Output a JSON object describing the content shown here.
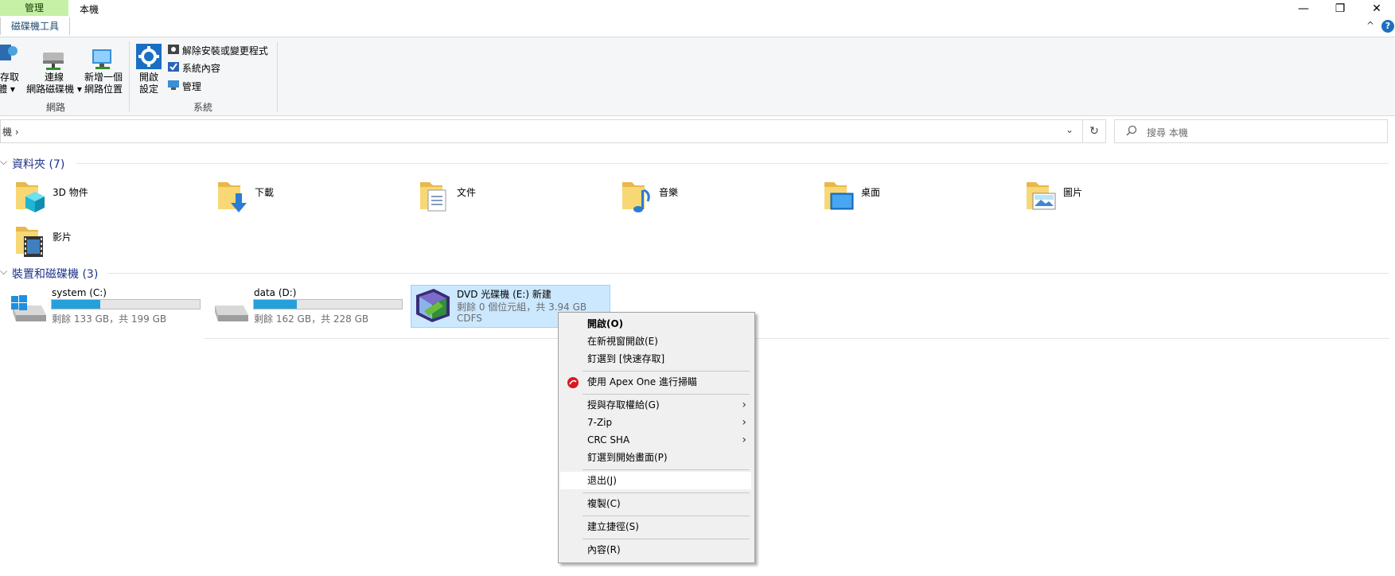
{
  "title": {
    "manage_tab": "管理",
    "context_tab": "磁碟機工具",
    "window_title": "本機"
  },
  "window_controls": {
    "minimize": "—",
    "maximize": "❐",
    "close": "✕",
    "collapse": "^",
    "help": "?"
  },
  "ribbon": {
    "network_group": {
      "label": "網路",
      "access_media": [
        "存取",
        "媒體 ▾"
      ],
      "map_drive": [
        "連線",
        "網路磁碟機 ▾"
      ],
      "add_location": [
        "新增一個",
        "網路位置"
      ]
    },
    "system_group": {
      "label": "系統",
      "open_settings": [
        "開啟",
        "設定"
      ],
      "uninstall": "解除安裝或變更程式",
      "system_properties": "系統內容",
      "manage": "管理"
    }
  },
  "address": {
    "path": "機 ›",
    "search_placeholder": "搜尋 本機"
  },
  "folders_section": {
    "heading": "資料夾 (7)",
    "items": [
      {
        "label": "3D 物件",
        "icon": "3d-objects-folder-icon"
      },
      {
        "label": "下載",
        "icon": "downloads-folder-icon"
      },
      {
        "label": "文件",
        "icon": "documents-folder-icon"
      },
      {
        "label": "音樂",
        "icon": "music-folder-icon"
      },
      {
        "label": "桌面",
        "icon": "desktop-folder-icon"
      },
      {
        "label": "圖片",
        "icon": "pictures-folder-icon"
      },
      {
        "label": "影片",
        "icon": "videos-folder-icon"
      }
    ]
  },
  "devices_section": {
    "heading": "裝置和磁碟機 (3)",
    "drives": [
      {
        "name": "system (C:)",
        "free": "剩餘 133 GB，共 199 GB",
        "used_fraction": 0.33
      },
      {
        "name": "data (D:)",
        "free": "剩餘 162 GB，共 228 GB",
        "used_fraction": 0.29
      },
      {
        "name": "DVD 光碟機 (E:) 新建",
        "free": "剩餘 0 個位元組，共 3.94 GB",
        "fs": "CDFS"
      }
    ]
  },
  "context_menu": {
    "items": {
      "open": "開啟(O)",
      "open_new_window": "在新視窗開啟(E)",
      "pin_quick": "釘選到 [快速存取]",
      "apex_scan": "使用 Apex One 進行掃瞄",
      "grant_access": "授與存取權給(G)",
      "zip": "7-Zip",
      "crc": "CRC SHA",
      "pin_start": "釘選到開始畫面(P)",
      "eject": "退出(J)",
      "copy": "複製(C)",
      "shortcut": "建立捷徑(S)",
      "properties": "內容(R)"
    },
    "submenu_arrow": "›"
  },
  "colors": {
    "manage_tab_bg": "#c5f0a6",
    "section_heading": "#1e3287",
    "drive_fill": "#26a0da",
    "selection_bg": "#cce8ff"
  }
}
